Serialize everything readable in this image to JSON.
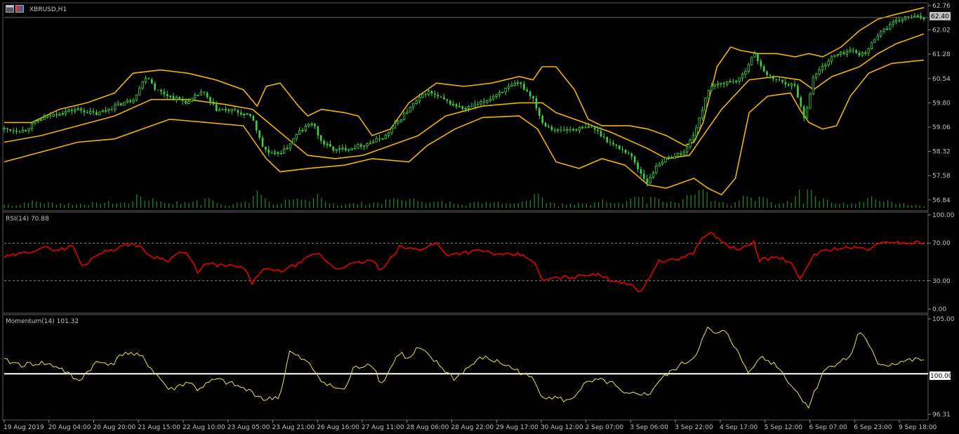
{
  "colors": {
    "background": "#000000",
    "grid": "#3a3a3a",
    "candle": "#3cd23c",
    "volume": "#1f8f1f",
    "bands": "#f0b400",
    "rsi_line": "#e60000",
    "momentum_line": "#e6e64a",
    "momentum_ref": "#ffffff",
    "axis_text": "#c0c0c0"
  },
  "header": {
    "symbol_timeframe": "XBRUSD,H1",
    "icon": "chart-window-icon"
  },
  "price_panel": {
    "current_price_label": "62.40",
    "chart_data": {
      "type": "candlestick",
      "overlays": [
        "Bollinger Bands (upper, middle, lower)",
        "volume histogram"
      ],
      "ylim": [
        56.6,
        62.76
      ],
      "y_ticks": [
        "62.76",
        "62.02",
        "61.28",
        "60.54",
        "59.80",
        "59.06",
        "58.32",
        "57.58",
        "56.84"
      ],
      "close_points": [
        [
          0,
          59.0
        ],
        [
          0.02,
          58.95
        ],
        [
          0.04,
          59.3
        ],
        [
          0.06,
          59.5
        ],
        [
          0.08,
          59.6
        ],
        [
          0.1,
          59.45
        ],
        [
          0.12,
          59.7
        ],
        [
          0.14,
          59.9
        ],
        [
          0.155,
          60.65
        ],
        [
          0.165,
          60.2
        ],
        [
          0.18,
          60.0
        ],
        [
          0.2,
          59.8
        ],
        [
          0.215,
          60.15
        ],
        [
          0.23,
          59.6
        ],
        [
          0.25,
          59.55
        ],
        [
          0.27,
          59.35
        ],
        [
          0.28,
          58.5
        ],
        [
          0.29,
          58.2
        ],
        [
          0.305,
          58.35
        ],
        [
          0.32,
          58.9
        ],
        [
          0.335,
          59.2
        ],
        [
          0.345,
          58.6
        ],
        [
          0.36,
          58.35
        ],
        [
          0.38,
          58.45
        ],
        [
          0.4,
          58.6
        ],
        [
          0.415,
          58.8
        ],
        [
          0.43,
          59.3
        ],
        [
          0.445,
          59.75
        ],
        [
          0.46,
          60.15
        ],
        [
          0.48,
          59.85
        ],
        [
          0.5,
          59.6
        ],
        [
          0.52,
          59.8
        ],
        [
          0.54,
          60.15
        ],
        [
          0.56,
          60.4
        ],
        [
          0.575,
          59.95
        ],
        [
          0.585,
          59.2
        ],
        [
          0.6,
          58.95
        ],
        [
          0.62,
          59.0
        ],
        [
          0.64,
          59.05
        ],
        [
          0.66,
          58.55
        ],
        [
          0.68,
          58.25
        ],
        [
          0.69,
          57.75
        ],
        [
          0.7,
          57.35
        ],
        [
          0.71,
          57.95
        ],
        [
          0.725,
          58.15
        ],
        [
          0.74,
          58.3
        ],
        [
          0.755,
          59.2
        ],
        [
          0.765,
          60.2
        ],
        [
          0.78,
          60.4
        ],
        [
          0.8,
          60.5
        ],
        [
          0.815,
          61.3
        ],
        [
          0.83,
          60.6
        ],
        [
          0.845,
          60.45
        ],
        [
          0.86,
          60.3
        ],
        [
          0.87,
          59.3
        ],
        [
          0.88,
          60.6
        ],
        [
          0.9,
          61.2
        ],
        [
          0.92,
          61.4
        ],
        [
          0.935,
          61.25
        ],
        [
          0.95,
          61.9
        ],
        [
          0.965,
          62.2
        ],
        [
          0.98,
          62.4
        ],
        [
          1.0,
          62.4
        ]
      ],
      "upper_points": [
        [
          0,
          59.2
        ],
        [
          0.03,
          59.2
        ],
        [
          0.06,
          59.6
        ],
        [
          0.09,
          59.8
        ],
        [
          0.12,
          60.1
        ],
        [
          0.14,
          60.7
        ],
        [
          0.17,
          60.8
        ],
        [
          0.2,
          60.7
        ],
        [
          0.23,
          60.5
        ],
        [
          0.26,
          60.2
        ],
        [
          0.275,
          59.7
        ],
        [
          0.285,
          60.3
        ],
        [
          0.3,
          60.4
        ],
        [
          0.32,
          59.7
        ],
        [
          0.33,
          59.4
        ],
        [
          0.345,
          59.6
        ],
        [
          0.37,
          59.5
        ],
        [
          0.385,
          59.4
        ],
        [
          0.4,
          58.8
        ],
        [
          0.42,
          59.0
        ],
        [
          0.44,
          59.8
        ],
        [
          0.47,
          60.4
        ],
        [
          0.5,
          60.3
        ],
        [
          0.53,
          60.4
        ],
        [
          0.56,
          60.6
        ],
        [
          0.575,
          60.5
        ],
        [
          0.585,
          60.9
        ],
        [
          0.6,
          60.9
        ],
        [
          0.62,
          60.2
        ],
        [
          0.635,
          59.3
        ],
        [
          0.65,
          59.1
        ],
        [
          0.68,
          59.1
        ],
        [
          0.7,
          59.0
        ],
        [
          0.72,
          58.8
        ],
        [
          0.74,
          58.5
        ],
        [
          0.75,
          58.6
        ],
        [
          0.76,
          59.2
        ],
        [
          0.775,
          60.9
        ],
        [
          0.79,
          61.5
        ],
        [
          0.8,
          61.4
        ],
        [
          0.82,
          61.3
        ],
        [
          0.84,
          61.3
        ],
        [
          0.86,
          61.2
        ],
        [
          0.875,
          61.3
        ],
        [
          0.89,
          61.2
        ],
        [
          0.91,
          61.5
        ],
        [
          0.93,
          62.0
        ],
        [
          0.95,
          62.35
        ],
        [
          0.97,
          62.5
        ],
        [
          1.0,
          62.7
        ]
      ],
      "middle_points": [
        [
          0,
          58.6
        ],
        [
          0.04,
          58.8
        ],
        [
          0.08,
          59.1
        ],
        [
          0.12,
          59.4
        ],
        [
          0.16,
          59.9
        ],
        [
          0.2,
          59.9
        ],
        [
          0.24,
          59.75
        ],
        [
          0.27,
          59.6
        ],
        [
          0.3,
          58.9
        ],
        [
          0.33,
          58.2
        ],
        [
          0.36,
          58.1
        ],
        [
          0.39,
          58.2
        ],
        [
          0.42,
          58.5
        ],
        [
          0.45,
          58.8
        ],
        [
          0.48,
          59.4
        ],
        [
          0.52,
          59.7
        ],
        [
          0.56,
          59.8
        ],
        [
          0.585,
          59.8
        ],
        [
          0.6,
          59.5
        ],
        [
          0.63,
          59.2
        ],
        [
          0.66,
          58.9
        ],
        [
          0.7,
          58.4
        ],
        [
          0.72,
          58.1
        ],
        [
          0.745,
          58.2
        ],
        [
          0.76,
          58.8
        ],
        [
          0.78,
          59.6
        ],
        [
          0.81,
          60.5
        ],
        [
          0.84,
          60.6
        ],
        [
          0.865,
          60.5
        ],
        [
          0.88,
          60.2
        ],
        [
          0.9,
          60.6
        ],
        [
          0.93,
          60.9
        ],
        [
          0.95,
          61.3
        ],
        [
          0.97,
          61.6
        ],
        [
          1.0,
          61.9
        ]
      ],
      "lower_points": [
        [
          0,
          58.0
        ],
        [
          0.04,
          58.3
        ],
        [
          0.08,
          58.6
        ],
        [
          0.12,
          58.7
        ],
        [
          0.15,
          59.0
        ],
        [
          0.18,
          59.3
        ],
        [
          0.22,
          59.2
        ],
        [
          0.26,
          59.1
        ],
        [
          0.285,
          58.1
        ],
        [
          0.3,
          57.7
        ],
        [
          0.33,
          57.8
        ],
        [
          0.37,
          57.9
        ],
        [
          0.4,
          58.1
        ],
        [
          0.44,
          58.0
        ],
        [
          0.46,
          58.5
        ],
        [
          0.49,
          59.0
        ],
        [
          0.52,
          59.35
        ],
        [
          0.56,
          59.4
        ],
        [
          0.58,
          59.0
        ],
        [
          0.6,
          58.0
        ],
        [
          0.625,
          57.8
        ],
        [
          0.65,
          58.1
        ],
        [
          0.675,
          57.9
        ],
        [
          0.7,
          57.3
        ],
        [
          0.72,
          57.2
        ],
        [
          0.75,
          57.5
        ],
        [
          0.765,
          57.2
        ],
        [
          0.78,
          57.0
        ],
        [
          0.795,
          57.5
        ],
        [
          0.81,
          59.5
        ],
        [
          0.83,
          60.0
        ],
        [
          0.855,
          60.1
        ],
        [
          0.865,
          59.6
        ],
        [
          0.875,
          59.2
        ],
        [
          0.89,
          59.0
        ],
        [
          0.905,
          59.1
        ],
        [
          0.92,
          60.0
        ],
        [
          0.94,
          60.7
        ],
        [
          0.965,
          61.0
        ],
        [
          1.0,
          61.1
        ]
      ]
    }
  },
  "rsi_panel": {
    "label": "RSI(14) 70.88",
    "chart_data": {
      "type": "line",
      "ylim": [
        0,
        100
      ],
      "y_ticks": [
        "100.00",
        "70.00",
        "30.00",
        "0.00"
      ],
      "levels": [
        70,
        30
      ],
      "points": [
        [
          0,
          55
        ],
        [
          0.02,
          59
        ],
        [
          0.04,
          65
        ],
        [
          0.06,
          63
        ],
        [
          0.075,
          67
        ],
        [
          0.085,
          44
        ],
        [
          0.1,
          58
        ],
        [
          0.12,
          64
        ],
        [
          0.14,
          70
        ],
        [
          0.15,
          64
        ],
        [
          0.16,
          56
        ],
        [
          0.18,
          52
        ],
        [
          0.19,
          61
        ],
        [
          0.2,
          57
        ],
        [
          0.21,
          40
        ],
        [
          0.22,
          48
        ],
        [
          0.24,
          46
        ],
        [
          0.26,
          44
        ],
        [
          0.27,
          27
        ],
        [
          0.28,
          42
        ],
        [
          0.3,
          40
        ],
        [
          0.32,
          48
        ],
        [
          0.34,
          60
        ],
        [
          0.36,
          43
        ],
        [
          0.38,
          48
        ],
        [
          0.4,
          52
        ],
        [
          0.41,
          40
        ],
        [
          0.43,
          66
        ],
        [
          0.45,
          63
        ],
        [
          0.47,
          70
        ],
        [
          0.48,
          58
        ],
        [
          0.5,
          60
        ],
        [
          0.52,
          62
        ],
        [
          0.54,
          57
        ],
        [
          0.56,
          58
        ],
        [
          0.575,
          52
        ],
        [
          0.585,
          30
        ],
        [
          0.6,
          33
        ],
        [
          0.62,
          34
        ],
        [
          0.64,
          38
        ],
        [
          0.66,
          31
        ],
        [
          0.68,
          27
        ],
        [
          0.69,
          18
        ],
        [
          0.7,
          30
        ],
        [
          0.71,
          50
        ],
        [
          0.73,
          52
        ],
        [
          0.75,
          60
        ],
        [
          0.76,
          78
        ],
        [
          0.77,
          80
        ],
        [
          0.785,
          68
        ],
        [
          0.8,
          62
        ],
        [
          0.815,
          72
        ],
        [
          0.82,
          52
        ],
        [
          0.84,
          55
        ],
        [
          0.855,
          50
        ],
        [
          0.865,
          30
        ],
        [
          0.88,
          58
        ],
        [
          0.9,
          64
        ],
        [
          0.92,
          65
        ],
        [
          0.94,
          64
        ],
        [
          0.96,
          72
        ],
        [
          0.98,
          70
        ],
        [
          1.0,
          71
        ]
      ]
    }
  },
  "momentum_panel": {
    "label": "Momentum(14) 101.32",
    "chart_data": {
      "type": "line",
      "ylim": [
        96.31,
        105.0
      ],
      "y_ticks": [
        "105.00",
        "100.00",
        "96.31"
      ],
      "ref_level": 100.0,
      "ref_label": "100.00",
      "points": [
        [
          0,
          101.2
        ],
        [
          0.02,
          100.8
        ],
        [
          0.04,
          101.0
        ],
        [
          0.06,
          100.6
        ],
        [
          0.08,
          99.3
        ],
        [
          0.1,
          101.0
        ],
        [
          0.12,
          101.0
        ],
        [
          0.13,
          102.0
        ],
        [
          0.15,
          101.5
        ],
        [
          0.165,
          100.0
        ],
        [
          0.18,
          98.5
        ],
        [
          0.2,
          99.3
        ],
        [
          0.21,
          98.6
        ],
        [
          0.23,
          99.5
        ],
        [
          0.25,
          99.0
        ],
        [
          0.27,
          98.3
        ],
        [
          0.285,
          97.6
        ],
        [
          0.3,
          98.0
        ],
        [
          0.31,
          102.0
        ],
        [
          0.33,
          101.0
        ],
        [
          0.35,
          99.0
        ],
        [
          0.37,
          98.5
        ],
        [
          0.38,
          100.5
        ],
        [
          0.4,
          101.0
        ],
        [
          0.41,
          99.0
        ],
        [
          0.43,
          102.0
        ],
        [
          0.44,
          101.2
        ],
        [
          0.45,
          102.4
        ],
        [
          0.47,
          101.0
        ],
        [
          0.49,
          99.5
        ],
        [
          0.5,
          100.3
        ],
        [
          0.52,
          101.5
        ],
        [
          0.54,
          101.0
        ],
        [
          0.56,
          100.2
        ],
        [
          0.575,
          99.5
        ],
        [
          0.585,
          98.0
        ],
        [
          0.6,
          97.8
        ],
        [
          0.615,
          97.5
        ],
        [
          0.63,
          99.0
        ],
        [
          0.645,
          99.4
        ],
        [
          0.66,
          99.2
        ],
        [
          0.675,
          98.0
        ],
        [
          0.69,
          98.3
        ],
        [
          0.7,
          98.0
        ],
        [
          0.71,
          99.2
        ],
        [
          0.73,
          100.5
        ],
        [
          0.75,
          101.5
        ],
        [
          0.765,
          104.1
        ],
        [
          0.775,
          103.5
        ],
        [
          0.785,
          104.0
        ],
        [
          0.8,
          101.5
        ],
        [
          0.81,
          100.0
        ],
        [
          0.82,
          101.6
        ],
        [
          0.84,
          100.8
        ],
        [
          0.86,
          98.5
        ],
        [
          0.875,
          97.0
        ],
        [
          0.89,
          100.2
        ],
        [
          0.905,
          101.0
        ],
        [
          0.92,
          101.5
        ],
        [
          0.93,
          104.0
        ],
        [
          0.94,
          102.5
        ],
        [
          0.95,
          101.0
        ],
        [
          0.96,
          100.8
        ],
        [
          0.98,
          101.2
        ],
        [
          1.0,
          101.3
        ]
      ]
    }
  },
  "time_axis": {
    "labels": [
      "19 Aug 2019",
      "20 Aug 04:00",
      "20 Aug 20:00",
      "21 Aug 15:00",
      "22 Aug 10:00",
      "23 Aug 05:00",
      "23 Aug 21:00",
      "26 Aug 16:00",
      "27 Aug 11:00",
      "28 Aug 06:00",
      "28 Aug 22:00",
      "29 Aug 17:00",
      "30 Aug 12:00",
      "2 Sep 07:00",
      "3 Sep 06:00",
      "3 Sep 22:00",
      "4 Sep 17:00",
      "5 Sep 12:00",
      "6 Sep 07:00",
      "6 Sep 23:00",
      "9 Sep 18:00"
    ]
  }
}
